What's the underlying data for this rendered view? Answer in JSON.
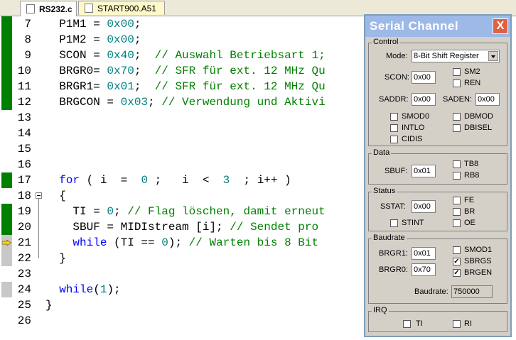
{
  "tabs": [
    {
      "label": "RS232.c",
      "active": true
    },
    {
      "label": "START900.A51",
      "active": false
    }
  ],
  "editor": {
    "lines": [
      {
        "num": "7",
        "mark": "green",
        "parts": [
          [
            "",
            "  P1M1 = "
          ],
          [
            "num",
            "0x00"
          ],
          [
            "",
            ";"
          ]
        ]
      },
      {
        "num": "8",
        "mark": "green",
        "parts": [
          [
            "",
            "  P1M2 = "
          ],
          [
            "num",
            "0x00"
          ],
          [
            "",
            ";"
          ]
        ]
      },
      {
        "num": "9",
        "mark": "green",
        "parts": [
          [
            "",
            "  SCON = "
          ],
          [
            "num",
            "0x40"
          ],
          [
            "",
            ";  "
          ],
          [
            "cmt",
            "// Auswahl Betriebsart 1;"
          ]
        ]
      },
      {
        "num": "10",
        "mark": "green",
        "parts": [
          [
            "",
            "  BRGR0= "
          ],
          [
            "num",
            "0x70"
          ],
          [
            "",
            ";  "
          ],
          [
            "cmt",
            "// SFR für ext. 12 MHz Qu"
          ]
        ]
      },
      {
        "num": "11",
        "mark": "green",
        "parts": [
          [
            "",
            "  BRGR1= "
          ],
          [
            "num",
            "0x01"
          ],
          [
            "",
            ";  "
          ],
          [
            "cmt",
            "// SFR für ext. 12 MHz Qu"
          ]
        ]
      },
      {
        "num": "12",
        "mark": "green",
        "parts": [
          [
            "",
            "  BRGCON = "
          ],
          [
            "num",
            "0x03"
          ],
          [
            "",
            "; "
          ],
          [
            "cmt",
            "// Verwendung und Aktivi"
          ]
        ]
      },
      {
        "num": "13",
        "mark": "none",
        "parts": []
      },
      {
        "num": "14",
        "mark": "none",
        "parts": []
      },
      {
        "num": "15",
        "mark": "none",
        "parts": []
      },
      {
        "num": "16",
        "mark": "none",
        "parts": []
      },
      {
        "num": "17",
        "mark": "green",
        "parts": [
          [
            "",
            "  "
          ],
          [
            "kw",
            "for"
          ],
          [
            "",
            " ( i  =  "
          ],
          [
            "num",
            "0"
          ],
          [
            "",
            " ;   i  <  "
          ],
          [
            "num",
            "3"
          ],
          [
            "",
            "  ; i++ )"
          ]
        ]
      },
      {
        "num": "18",
        "mark": "none",
        "fold": true,
        "parts": [
          [
            "",
            "  {"
          ]
        ]
      },
      {
        "num": "19",
        "mark": "green",
        "parts": [
          [
            "",
            "    TI = "
          ],
          [
            "num",
            "0"
          ],
          [
            "",
            "; "
          ],
          [
            "cmt",
            "// Flag löschen, damit erneut"
          ]
        ]
      },
      {
        "num": "20",
        "mark": "green",
        "parts": [
          [
            "",
            "    SBUF = MIDIstream [i]; "
          ],
          [
            "cmt",
            "// Sendet pro"
          ]
        ]
      },
      {
        "num": "21",
        "mark": "arrow",
        "parts": [
          [
            "",
            "    "
          ],
          [
            "kw",
            "while"
          ],
          [
            "",
            " (TI == "
          ],
          [
            "num",
            "0"
          ],
          [
            "",
            "); "
          ],
          [
            "cmt",
            "// Warten bis 8 Bit"
          ]
        ]
      },
      {
        "num": "22",
        "mark": "gray",
        "parts": [
          [
            "",
            "  }"
          ]
        ]
      },
      {
        "num": "23",
        "mark": "none",
        "parts": []
      },
      {
        "num": "24",
        "mark": "gray",
        "parts": [
          [
            "",
            "  "
          ],
          [
            "kw",
            "while"
          ],
          [
            "",
            "("
          ],
          [
            "num",
            "1"
          ],
          [
            "",
            ");"
          ]
        ]
      },
      {
        "num": "25",
        "mark": "none",
        "parts": [
          [
            "",
            "}"
          ]
        ]
      },
      {
        "num": "26",
        "mark": "none",
        "parts": []
      }
    ]
  },
  "dialog": {
    "title": "Serial  Channel",
    "close": "X",
    "control": {
      "label": "Control",
      "mode_label": "Mode:",
      "mode_value": "8-Bit Shift Register",
      "scon_label": "SCON:",
      "scon_value": "0x00",
      "saddr_label": "SADDR:",
      "saddr_value": "0x00",
      "saden_label": "SADEN:",
      "saden_value": "0x00",
      "checks": [
        {
          "label": "SM2",
          "checked": false
        },
        {
          "label": "REN",
          "checked": false
        },
        {
          "label": "SMOD0",
          "checked": false
        },
        {
          "label": "DBMOD",
          "checked": false
        },
        {
          "label": "INTLO",
          "checked": false
        },
        {
          "label": "DBISEL",
          "checked": false
        },
        {
          "label": "CIDIS",
          "checked": false
        }
      ]
    },
    "data": {
      "label": "Data",
      "sbuf_label": "SBUF:",
      "sbuf_value": "0x01",
      "checks": [
        {
          "label": "TB8",
          "checked": false
        },
        {
          "label": "RB8",
          "checked": false
        }
      ]
    },
    "status": {
      "label": "Status",
      "sstat_label": "SSTAT:",
      "sstat_value": "0x00",
      "checks": [
        {
          "label": "FE",
          "checked": false
        },
        {
          "label": "BR",
          "checked": false
        },
        {
          "label": "STINT",
          "checked": false
        },
        {
          "label": "OE",
          "checked": false
        }
      ]
    },
    "baudrate": {
      "label": "Baudrate",
      "brgr1_label": "BRGR1:",
      "brgr1_value": "0x01",
      "brgr0_label": "BRGR0:",
      "brgr0_value": "0x70",
      "baud_label": "Baudrate:",
      "baud_value": "750000",
      "checks": [
        {
          "label": "SMOD1",
          "checked": false
        },
        {
          "label": "SBRGS",
          "checked": true
        },
        {
          "label": "BRGEN",
          "checked": true
        }
      ]
    },
    "irq": {
      "label": "IRQ",
      "checks": [
        {
          "label": "TI",
          "checked": false
        },
        {
          "label": "RI",
          "checked": false
        }
      ]
    }
  }
}
